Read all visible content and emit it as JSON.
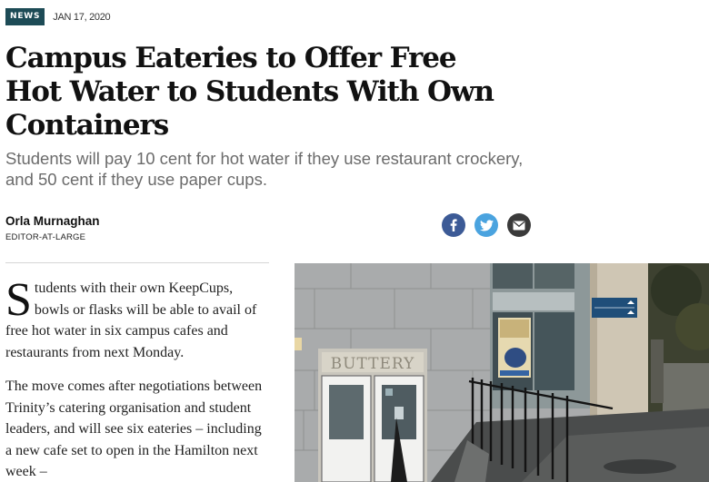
{
  "article": {
    "section_badge": "NEWS",
    "date": "JAN 17, 2020",
    "headline": "Campus Eateries to Offer Free Hot Water to Students With Own Containers",
    "standfirst": "Students will pay 10 cent for hot water if they use restaurant crockery, and 50 cent if they use paper cups.",
    "author": {
      "name": "Orla Murnaghan",
      "role": "EDITOR-AT-LARGE"
    },
    "share_icons": [
      "facebook-icon",
      "twitter-icon",
      "email-icon"
    ],
    "body": {
      "dropcap": "S",
      "p1_rest": "tudents with their own KeepCups, bowls or flasks will be able to avail of free hot water in six campus cafes and restaurants from next Monday.",
      "p2": "The move comes after negotiations between Trinity’s catering organisation and student leaders, and will see six eateries – including a new cafe set to open in the Hamilton next week –"
    },
    "photo": {
      "sign_text": "BUTTERY"
    }
  },
  "colors": {
    "badge": "#1d4b56",
    "facebook": "#3c5a96",
    "twitter": "#4aa3df",
    "email": "#3a3a3a",
    "standfirst": "#6b6b6b"
  }
}
